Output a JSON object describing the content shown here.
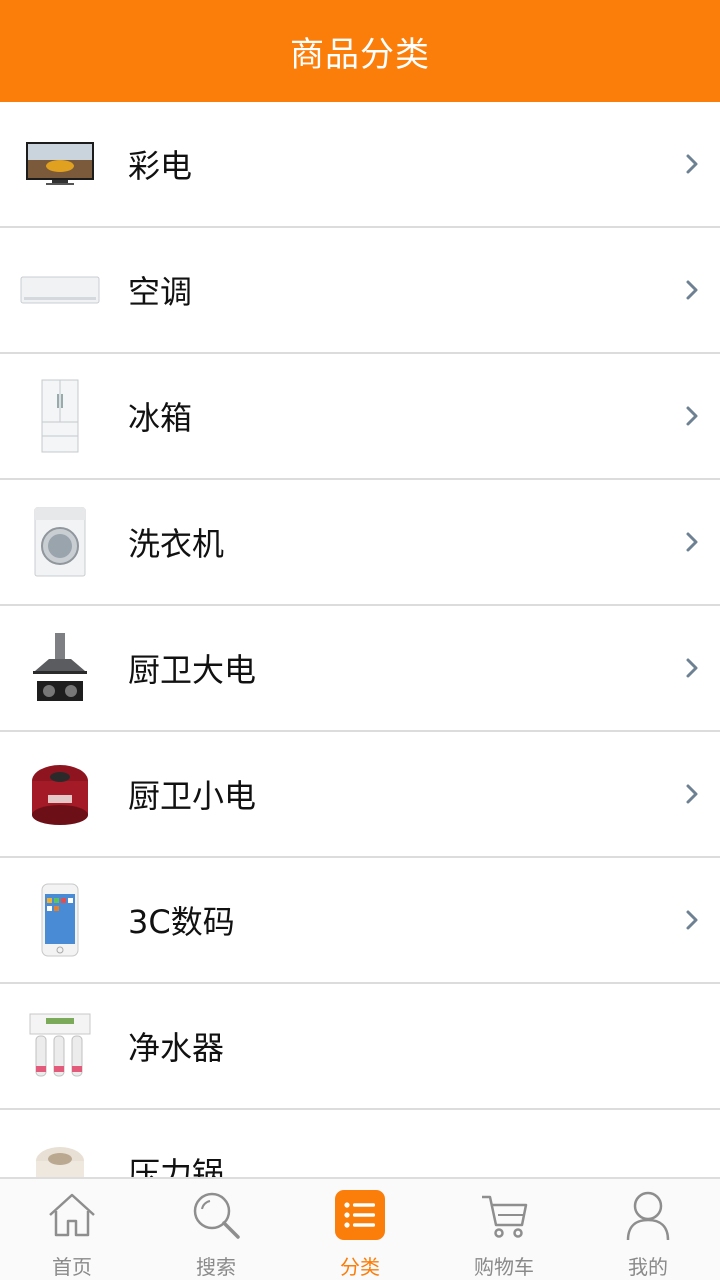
{
  "header": {
    "title": "商品分类"
  },
  "categories": [
    {
      "label": "彩电",
      "icon": "tv-image",
      "has_arrow": true
    },
    {
      "label": "空调",
      "icon": "air-conditioner-image",
      "has_arrow": true
    },
    {
      "label": "冰箱",
      "icon": "fridge-image",
      "has_arrow": true
    },
    {
      "label": "洗衣机",
      "icon": "washing-machine-image",
      "has_arrow": true
    },
    {
      "label": "厨卫大电",
      "icon": "range-hood-image",
      "has_arrow": true
    },
    {
      "label": "厨卫小电",
      "icon": "rice-cooker-image",
      "has_arrow": true
    },
    {
      "label": "3C数码",
      "icon": "smartphone-image",
      "has_arrow": true
    },
    {
      "label": "净水器",
      "icon": "water-purifier-image",
      "has_arrow": false
    },
    {
      "label": "压力锅",
      "icon": "pressure-cooker-image",
      "has_arrow": false
    }
  ],
  "tabbar": {
    "tabs": [
      {
        "label": "首页",
        "icon": "home-icon",
        "active": false
      },
      {
        "label": "搜索",
        "icon": "search-icon",
        "active": false
      },
      {
        "label": "分类",
        "icon": "list-icon",
        "active": true
      },
      {
        "label": "购物车",
        "icon": "cart-icon",
        "active": false
      },
      {
        "label": "我的",
        "icon": "user-icon",
        "active": false
      }
    ]
  },
  "colors": {
    "accent": "#fb7d0a",
    "chevron": "#6e8193",
    "divider": "#dcdcdc"
  }
}
